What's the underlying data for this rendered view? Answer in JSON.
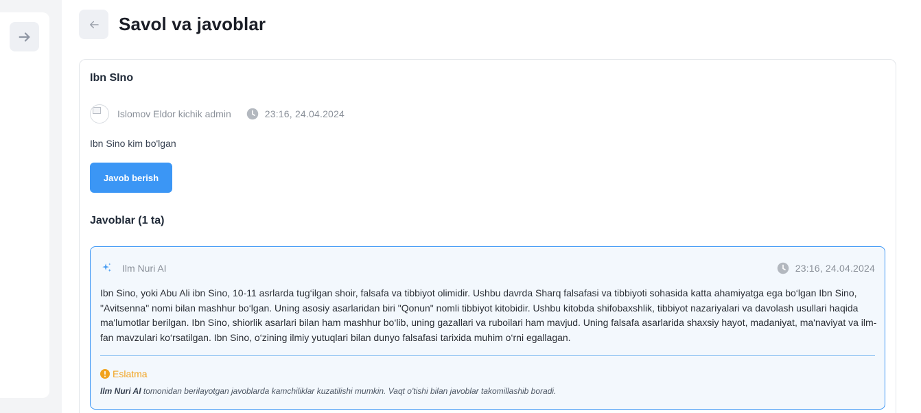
{
  "page": {
    "title": "Savol va javoblar"
  },
  "question": {
    "title": "Ibn SIno",
    "author": "Islomov Eldor kichik admin",
    "date": "23:16, 24.04.2024",
    "text": "Ibn Sino kim bo'lgan",
    "answer_button": "Javob berish"
  },
  "answers": {
    "heading": "Javoblar (1 ta)",
    "items": [
      {
        "author": "Ilm Nuri AI",
        "date": "23:16, 24.04.2024",
        "text": "Ibn Sino, yoki Abu Ali ibn Sino, 10-11 asrlarda tug‘ilgan shoir, falsafa va tibbiyot olimidir. Ushbu davrda Sharq falsafasi va tibbiyoti sohasida katta ahamiyatga ega bo‘lgan Ibn Sino, \"Avitsenna\" nomi bilan mashhur bo‘lgan. Uning asosiy asarlaridan biri \"Qonun\" nomli tibbiyot kitobidir. Ushbu kitobda shifobaxshlik, tibbiyot nazariyalari va davolash usullari haqida ma'lumotlar berilgan. Ibn Sino, shiorlik asarlari bilan ham mashhur bo‘lib, uning gazallari va ruboilari ham mavjud. Uning falsafa asarlarida shaxsiy hayot, madaniyat, ma'naviyat va ilm-fan mavzulari ko‘rsatilgan. Ibn Sino, o‘zining ilmiy yutuqlari bilan dunyo falsafasi tarixida muhim o‘rni egallagan.",
        "note_label": "Eslatma",
        "note_author": "Ilm Nuri AI",
        "note_text": " tomonidan berilayotgan javoblarda kamchiliklar kuzatilishi mumkin. Vaqt o'tishi bilan javoblar takomillashib boradi."
      }
    ]
  },
  "colors": {
    "accent": "#3b96f5",
    "warning": "#f1a21d",
    "muted": "#8a9099"
  },
  "icons": {
    "sidebar_toggle": "arrow-right-icon",
    "back": "arrow-left-icon",
    "time": "clock-icon",
    "ai": "sparkle-icon",
    "note": "exclamation-circle-icon"
  }
}
